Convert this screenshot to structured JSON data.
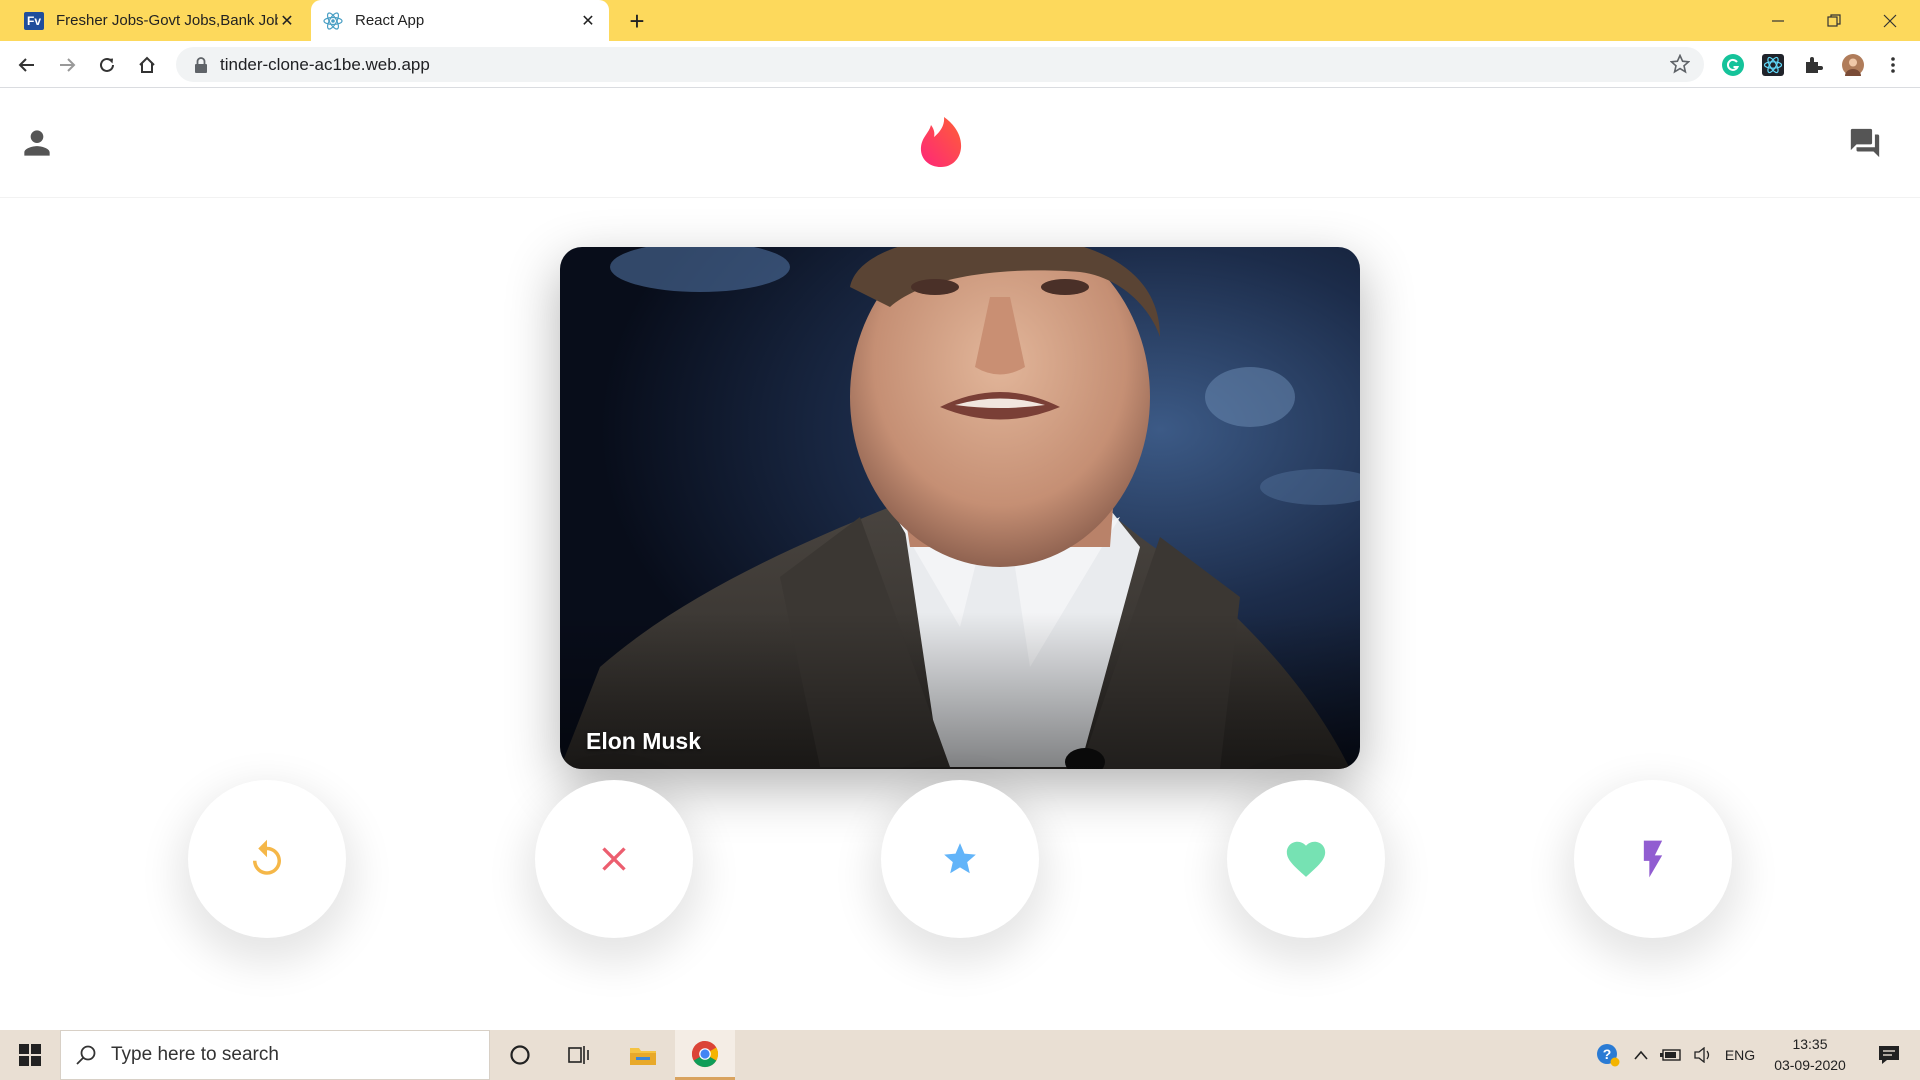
{
  "browser": {
    "tabs": [
      {
        "title": "Fresher Jobs-Govt Jobs,Bank Jobs",
        "favicon_text": "Fv",
        "active": false
      },
      {
        "title": "React App",
        "favicon": "react-icon",
        "active": true
      }
    ],
    "url": "tinder-clone-ac1be.web.app",
    "accent_color": "#fdd95c"
  },
  "app": {
    "logo": "tinder-flame-icon",
    "brand_color": "#fd5068",
    "card": {
      "name": "Elon Musk"
    },
    "buttons": [
      {
        "icon": "replay-icon",
        "color": "#f5b748"
      },
      {
        "icon": "close-icon",
        "color": "#ec5e6f"
      },
      {
        "icon": "star-icon",
        "color": "#62b4f9"
      },
      {
        "icon": "heart-icon",
        "color": "#76e2b3"
      },
      {
        "icon": "flash-icon",
        "color": "#915dd1"
      }
    ]
  },
  "taskbar": {
    "search_placeholder": "Type here to search",
    "language": "ENG",
    "time": "13:35",
    "date": "03-09-2020"
  }
}
